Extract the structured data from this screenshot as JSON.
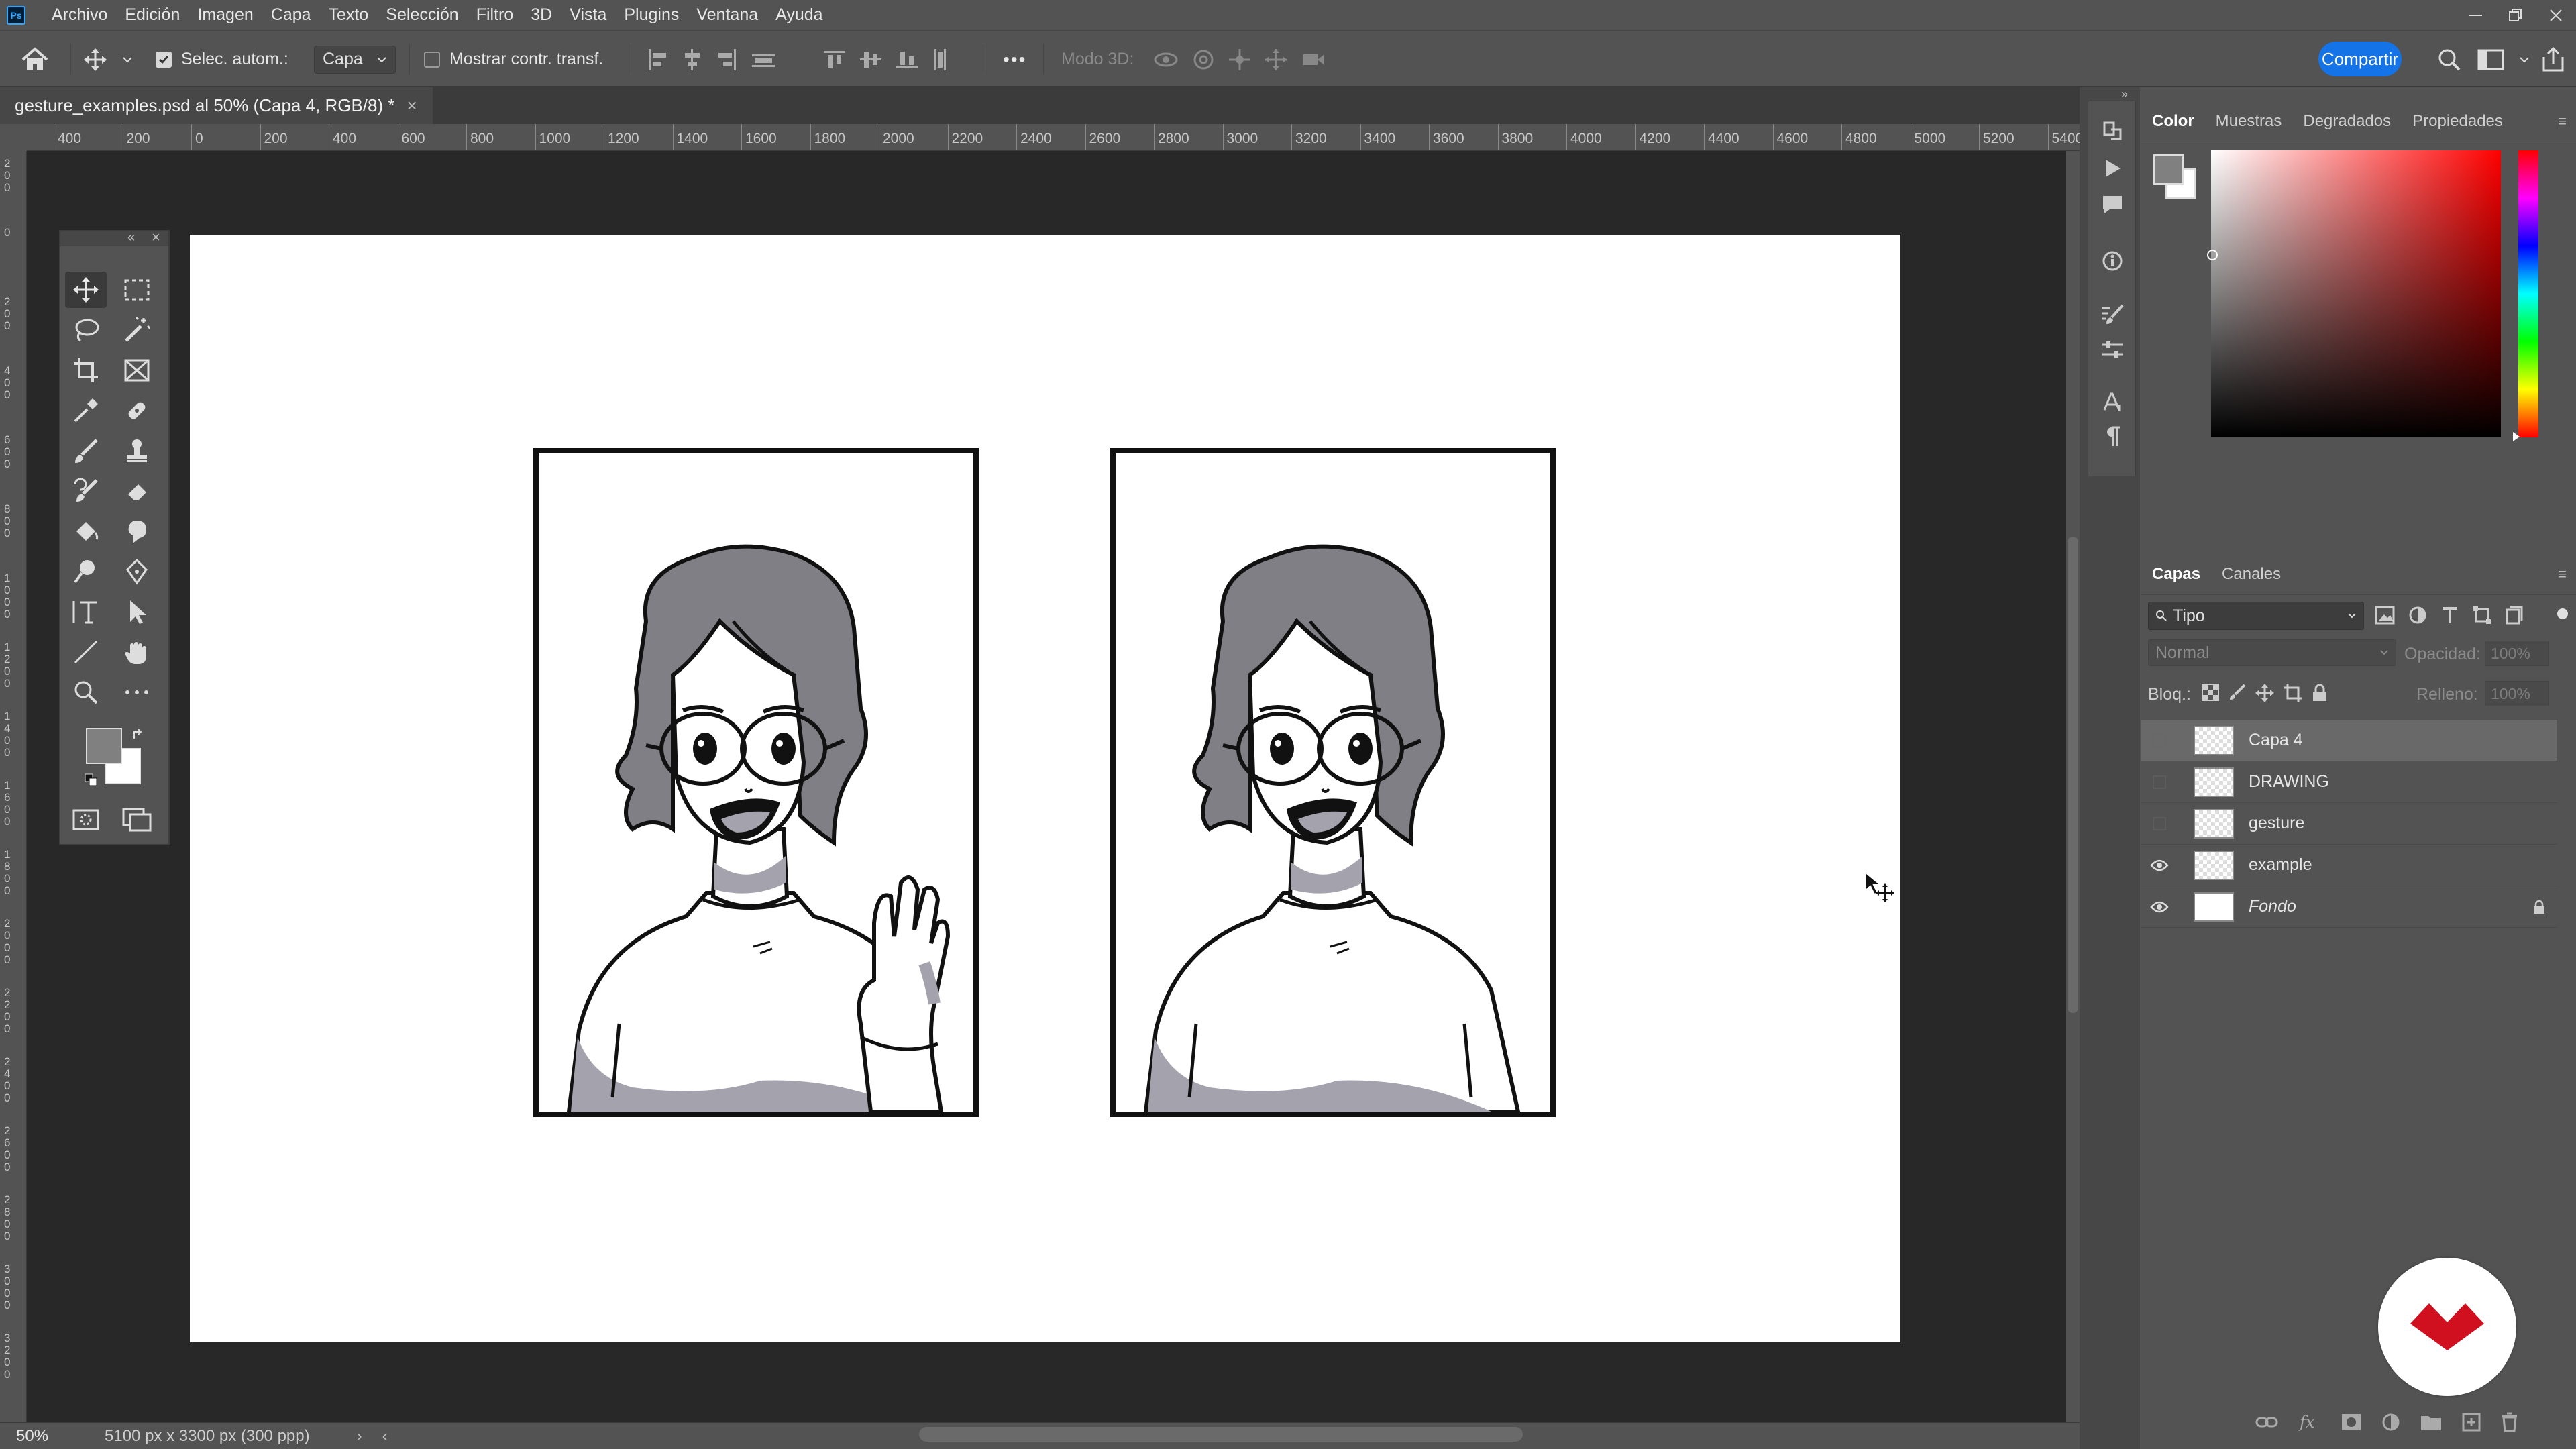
{
  "app": {
    "logo": "Ps"
  },
  "menu": [
    "Archivo",
    "Edición",
    "Imagen",
    "Capa",
    "Texto",
    "Selección",
    "Filtro",
    "3D",
    "Vista",
    "Plugins",
    "Ventana",
    "Ayuda"
  ],
  "options": {
    "auto_select_label": "Selec. autom.:",
    "auto_select_target": "Capa",
    "show_transform_label": "Mostrar contr. transf.",
    "mode_3d_label": "Modo 3D:",
    "more": "•••",
    "share_label": "Compartir"
  },
  "document": {
    "tab_title": "gesture_examples.psd al 50% (Capa 4, RGB/8) *",
    "close": "×"
  },
  "rulers": {
    "h_ticks": [
      "400",
      "200",
      "0",
      "200",
      "400",
      "600",
      "800",
      "1000",
      "1200",
      "1400",
      "1600",
      "1800",
      "2000",
      "2200",
      "2400",
      "2600",
      "2800",
      "3000",
      "3200",
      "3400",
      "3600",
      "3800",
      "4000",
      "4200",
      "4400",
      "4600",
      "4800",
      "5000",
      "5200",
      "5400"
    ],
    "v_ticks": [
      "200",
      "0",
      "200",
      "400",
      "600",
      "800",
      "1000",
      "1200",
      "1400",
      "1600",
      "1800",
      "2000",
      "2200",
      "2400",
      "2600",
      "2800",
      "3000",
      "3200"
    ]
  },
  "status": {
    "zoom": "50%",
    "doc_size": "5100 px x 3300 px (300 ppp)"
  },
  "color_panel": {
    "tabs": [
      "Color",
      "Muestras",
      "Degradados",
      "Propiedades"
    ],
    "active_tab": "Color",
    "foreground": "#808080",
    "background": "#ffffff",
    "hue_base": "#ff0000"
  },
  "layers_panel": {
    "tabs": [
      "Capas",
      "Canales"
    ],
    "active_tab": "Capas",
    "filter_label": "Tipo",
    "blend_mode": "Normal",
    "opacity_label": "Opacidad:",
    "opacity_value": "100%",
    "lock_label": "Bloq.:",
    "fill_label": "Relleno:",
    "fill_value": "100%",
    "layers": [
      {
        "name": "Capa 4",
        "visible": false,
        "selected": true
      },
      {
        "name": "DRAWING",
        "visible": false,
        "selected": false
      },
      {
        "name": "gesture",
        "visible": false,
        "selected": false
      },
      {
        "name": "example",
        "visible": true,
        "selected": false
      },
      {
        "name": "Fondo",
        "visible": true,
        "selected": false,
        "locked": true
      }
    ]
  },
  "colors": {
    "accent": "#1473e6",
    "badge": "#d00f1f",
    "hair": "#807f85",
    "shadow": "#a3a2ad"
  }
}
